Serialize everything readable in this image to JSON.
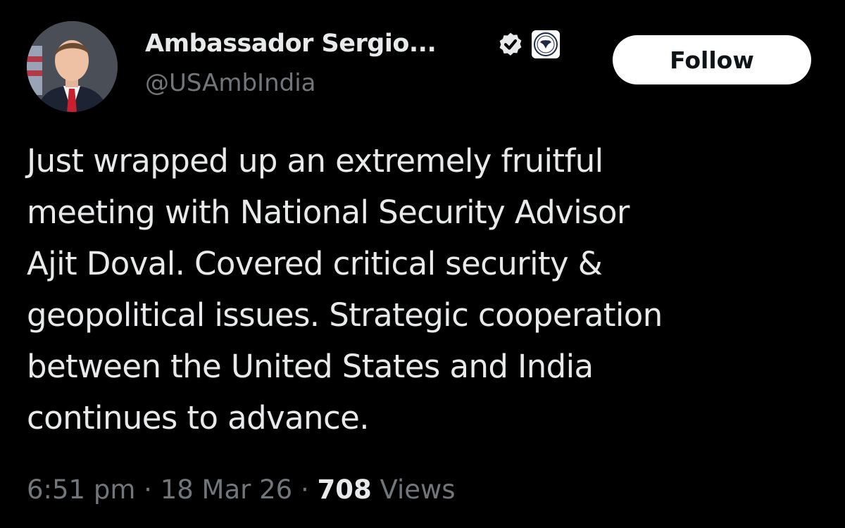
{
  "author": {
    "display_name": "Ambassador Sergio...",
    "handle": "@USAmbIndia",
    "verified_badge_icon": "verified-check-icon",
    "affiliate_badge_icon": "state-department-seal-icon",
    "verified_color": "#1d9bf0"
  },
  "follow_button": {
    "label": "Follow"
  },
  "tweet": {
    "text": "Just wrapped up an extremely fruitful\nmeeting with National Security Advisor\nAjit Doval. Covered critical security &\ngeopolitical issues. Strategic cooperation\nbetween the United States and India\ncontinues to advance."
  },
  "meta": {
    "time": "6:51 pm",
    "separator": "·",
    "date": "18 Mar 26",
    "views_count": "708",
    "views_label": "Views"
  },
  "colors": {
    "background": "#000000",
    "text_primary": "#e7e9ea",
    "text_secondary": "#71767b",
    "button_bg": "#ffffff"
  }
}
